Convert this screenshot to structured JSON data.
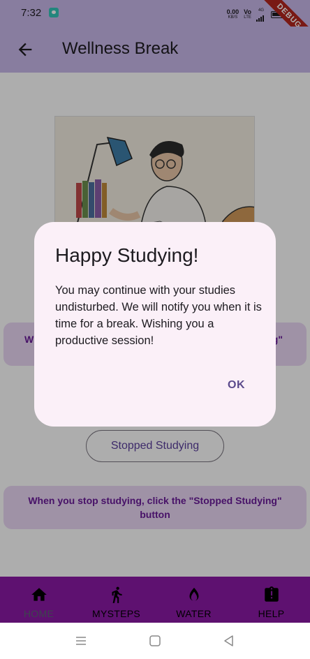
{
  "status_bar": {
    "time": "7:32",
    "net_speed_value": "0.00",
    "net_speed_unit": "KB/S",
    "volte_top": "Vo",
    "volte_bottom": "LTE",
    "network_type": "4G",
    "debug_banner": "DEBUG"
  },
  "app_bar": {
    "title": "Wellness Break",
    "back_icon": "arrow-left-icon"
  },
  "main": {
    "card_top": {
      "left_fragment": "W",
      "right_fragment": "g\""
    },
    "stopped_button_label": "Stopped Studying",
    "card_bottom_text": "When you stop studying, click the \"Stopped Studying\" button"
  },
  "bottom_nav": {
    "items": [
      {
        "label": "HOME",
        "icon": "home-icon"
      },
      {
        "label": "MYSTEPS",
        "icon": "walk-icon"
      },
      {
        "label": "WATER",
        "icon": "water-drop-icon"
      },
      {
        "label": "HELP",
        "icon": "help-clipboard-icon"
      }
    ]
  },
  "dialog": {
    "title": "Happy Studying!",
    "body": "You may continue with your studies undisturbed. We will notify you when it is time for a break. Wishing you a productive session!",
    "ok_label": "OK"
  },
  "colors": {
    "app_bar": "#c9b8ea",
    "bottom_nav": "#8b1aa6",
    "info_card": "#ead8f5",
    "info_card_text": "#6a1b9a",
    "dialog_bg": "#fbf0f8"
  }
}
